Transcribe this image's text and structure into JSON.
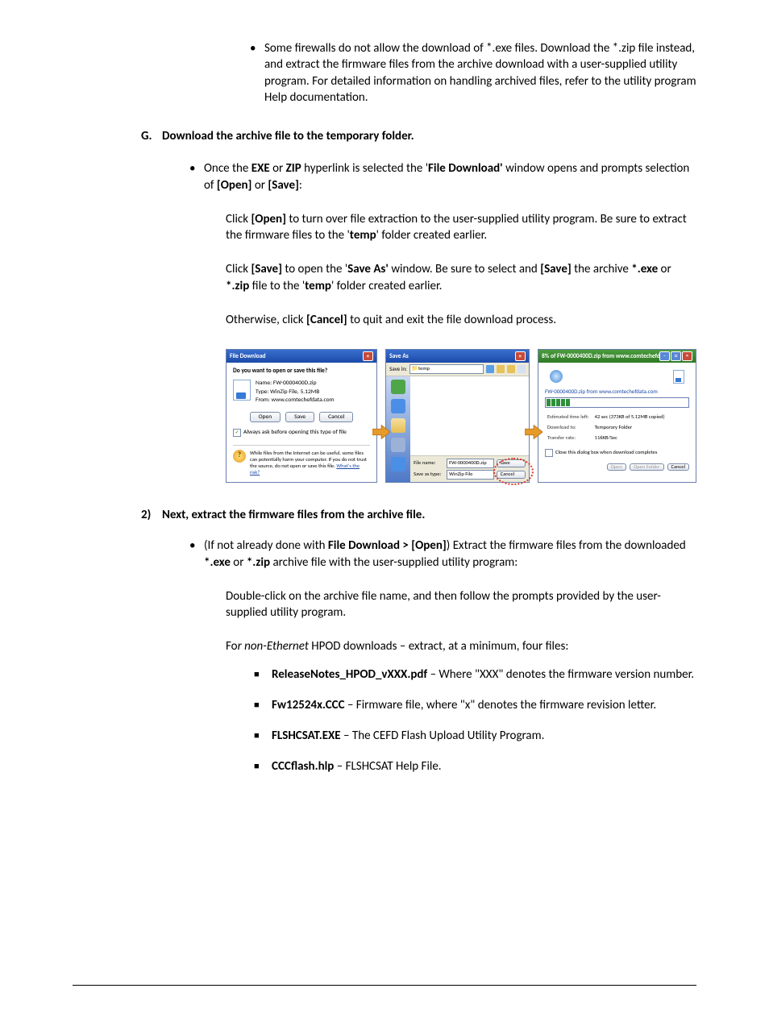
{
  "firstBullet": {
    "text": "Some firewalls do not allow the download of *.exe files. Download the *.zip file instead, and extract the firmware files from the archive download with a user-supplied utility program. For detailed information on handling archived files, refer to the utility program Help documentation."
  },
  "sectionG": {
    "letter": "G.",
    "title": "Download the archive file to the temporary folder.",
    "bullet1_pre": "Once the ",
    "bullet1_b1": "EXE",
    "bullet1_mid1": " or ",
    "bullet1_b2": "ZIP",
    "bullet1_mid2": " hyperlink is selected the '",
    "bullet1_b3": "File Download'",
    "bullet1_mid3": " window opens and prompts selection of ",
    "bullet1_b4": "[Open]",
    "bullet1_mid4": " or ",
    "bullet1_b5": "[Save]",
    "bullet1_end": ":",
    "p1a": "Click ",
    "p1b": "[Open]",
    "p1c": " to turn over file extraction to the user-supplied utility program. Be sure to extract the firmware files to the '",
    "p1d": "temp",
    "p1e": "' folder created earlier.",
    "p2a": "Click ",
    "p2b": "[Save]",
    "p2c": " to open the '",
    "p2d": "Save As'",
    "p2e": " window. Be sure to select and ",
    "p2f": "[Save]",
    "p2g": " the archive ",
    "p2h": "*.exe",
    "p2i": " or ",
    "p2j": "*.zip",
    "p2k": " file to the '",
    "p2l": "temp",
    "p2m": "' folder created earlier.",
    "p3a": "Otherwise, click ",
    "p3b": "[Cancel]",
    "p3c": " to quit and exit the file download process."
  },
  "fileDownload": {
    "title": "File Download",
    "question": "Do you want to open or save this file?",
    "name_lbl": "Name:",
    "name_val": "FW-0000400D.zip",
    "type_lbl": "Type:",
    "type_val": "WinZip File, 5.12MB",
    "from_lbl": "From:",
    "from_val": "www.comtechefdata.com",
    "open": "Open",
    "save": "Save",
    "cancel": "Cancel",
    "always": "Always ask before opening this type of file",
    "warn": "While files from the Internet can be useful, some files can potentially harm your computer. If you do not trust the source, do not open or save this file. ",
    "risk": "What's the risk?"
  },
  "saveAs": {
    "title": "Save As",
    "savein_lbl": "Save in:",
    "savein_val": "temp",
    "filename_lbl": "File name:",
    "filename_val": "FW-0000400D.zip",
    "saveas_lbl": "Save as type:",
    "saveas_val": "WinZip File",
    "save": "Save",
    "cancel": "Cancel"
  },
  "progress": {
    "title": "8% of FW-0000400D.zip from www.comtechefdata.c…",
    "file": "FW-0000400D.zip from www.comtechefdata.com",
    "est_lbl": "Estimated time left:",
    "est_val": "42 sec (373KB of 5.12MB copied)",
    "dl_lbl": "Download to:",
    "dl_val": "Temporary Folder",
    "rate_lbl": "Transfer rate:",
    "rate_val": "116KB/Sec",
    "close_chk": "Close this dialog box when download completes",
    "open": "Open",
    "openfolder": "Open Folder",
    "cancel": "Cancel"
  },
  "section2": {
    "num": "2)",
    "title": "Next, extract the firmware files from the archive file.",
    "b1a": "(If not already done with ",
    "b1b": "File Download > [Open]",
    "b1c": ") Extract the firmware files from the downloaded ",
    "b1d": "*.exe",
    "b1e": " or ",
    "b1f": "*.zip",
    "b1g": " archive file with the user-supplied utility program:",
    "p1": "Double-click on the archive file name, and then follow the prompts provided by the user-supplied utility program.",
    "p2a": "Fo",
    "p2b": "r non-Ethernet",
    "p2c": " HPOD downloads – extract, at a minimum, four files:",
    "files": {
      "f1a": "ReleaseNotes_HPOD_vXXX.pdf",
      "f1b": " – Where \"XXX\" denotes the firmware version number.",
      "f2a": "Fw12524x.CCC",
      "f2b": " – Firmware file, where \"x\" denotes the firmware revision letter.",
      "f3a": "FLSHCSAT.EXE",
      "f3b": " – The CEFD Flash Upload Utility Program.",
      "f4a": "CCCflash.hlp",
      "f4b": " – FLSHCSAT Help File."
    }
  }
}
